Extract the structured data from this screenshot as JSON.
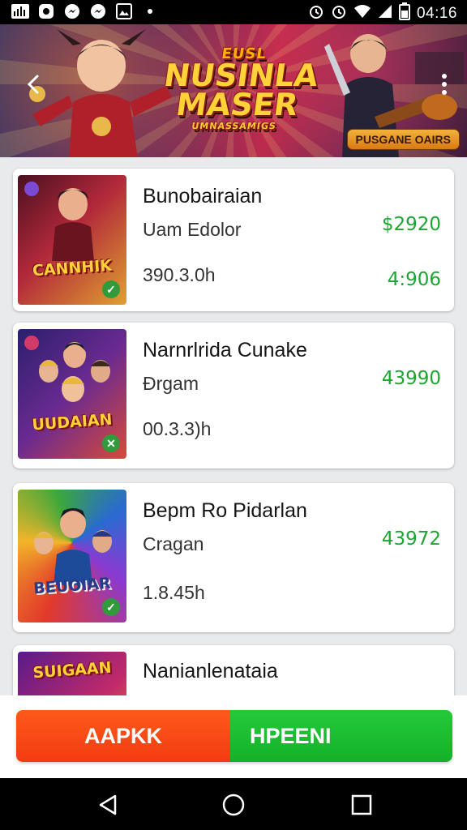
{
  "status_bar": {
    "time": "04:16",
    "left_icons": [
      "signal-bars-icon",
      "record-icon",
      "messenger-icon",
      "messenger-icon",
      "image-icon",
      "dot-icon"
    ],
    "right_icons": [
      "alarm-icon",
      "alarm-icon",
      "wifi-icon",
      "cell-signal-icon",
      "battery-icon"
    ]
  },
  "hero": {
    "small_title": "EUSL",
    "title_line1": "NUSINLA",
    "title_line2": "MASER",
    "subtitle": "UMNASSAMIGS",
    "badge": "PUSGANE OAIRS"
  },
  "items": [
    {
      "title": "Bunobairaian",
      "subtitle": "Uam Edolor",
      "meta": "390.3.0h",
      "price": "$2920",
      "value": "4:906",
      "thumb_title": "CANNHIK",
      "check": "✓"
    },
    {
      "title": "Narnrlrida Cunake",
      "subtitle": "Ðrgam",
      "meta": "00.3.3)h",
      "price": "43990",
      "value": "",
      "thumb_title": "UUDAIAN",
      "check": "✕"
    },
    {
      "title": "Bepm Ro Pidarlan",
      "subtitle": "Cragan",
      "meta": "1.8.45h",
      "price": "43972",
      "value": "",
      "thumb_title": "BEUOIAR",
      "check": "✓"
    },
    {
      "title": "Nanianlenataia",
      "subtitle": "",
      "meta": "",
      "price": "",
      "value": "",
      "thumb_title": "SUIGAAN",
      "check": ""
    }
  ],
  "actions": {
    "left_label": "AAPKK",
    "right_label": "HPEENI",
    "left_color": "#f23b12",
    "right_color": "#14b12a"
  },
  "nav_bar": {
    "buttons": [
      "back-triangle-icon",
      "home-circle-icon",
      "recents-square-icon"
    ]
  }
}
